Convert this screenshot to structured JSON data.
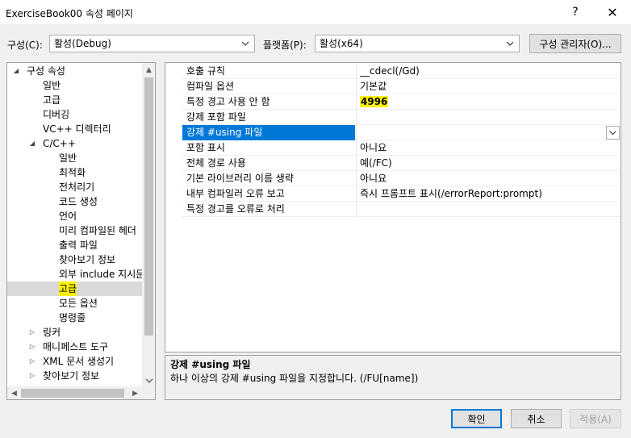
{
  "window": {
    "title": "ExerciseBook00 속성 페이지",
    "help_glyph": "?",
    "close_glyph": "✕"
  },
  "toolbar": {
    "config_label": "구성(C):",
    "config_value": "활성(Debug)",
    "platform_label": "플랫폼(P):",
    "platform_value": "활성(x64)",
    "config_manager_label": "구성 관리자(O)..."
  },
  "tree": {
    "items": [
      {
        "label": "구성 속성",
        "indent": 0,
        "expander": "expanded"
      },
      {
        "label": "일반",
        "indent": 1,
        "expander": "none"
      },
      {
        "label": "고급",
        "indent": 1,
        "expander": "none"
      },
      {
        "label": "디버깅",
        "indent": 1,
        "expander": "none"
      },
      {
        "label": "VC++ 디렉터리",
        "indent": 1,
        "expander": "none"
      },
      {
        "label": "C/C++",
        "indent": 1,
        "expander": "expanded"
      },
      {
        "label": "일반",
        "indent": 2,
        "expander": "none"
      },
      {
        "label": "최적화",
        "indent": 2,
        "expander": "none"
      },
      {
        "label": "전처리기",
        "indent": 2,
        "expander": "none"
      },
      {
        "label": "코드 생성",
        "indent": 2,
        "expander": "none"
      },
      {
        "label": "언어",
        "indent": 2,
        "expander": "none"
      },
      {
        "label": "미리 컴파일된 헤더",
        "indent": 2,
        "expander": "none"
      },
      {
        "label": "출력 파일",
        "indent": 2,
        "expander": "none"
      },
      {
        "label": "찾아보기 정보",
        "indent": 2,
        "expander": "none"
      },
      {
        "label": "외부 include 지시문",
        "indent": 2,
        "expander": "none"
      },
      {
        "label": "고급",
        "indent": 2,
        "expander": "none",
        "selected": true
      },
      {
        "label": "모든 옵션",
        "indent": 2,
        "expander": "none"
      },
      {
        "label": "명령줄",
        "indent": 2,
        "expander": "none"
      },
      {
        "label": "링커",
        "indent": 1,
        "expander": "collapsed"
      },
      {
        "label": "매니페스트 도구",
        "indent": 1,
        "expander": "collapsed"
      },
      {
        "label": "XML 문서 생성기",
        "indent": 1,
        "expander": "collapsed"
      },
      {
        "label": "찾아보기 정보",
        "indent": 1,
        "expander": "collapsed"
      }
    ]
  },
  "grid": {
    "rows": [
      {
        "name": "호출 규칙",
        "value": "__cdecl(/Gd)"
      },
      {
        "name": "컴파일 옵션",
        "value": "기본값"
      },
      {
        "name": "특정 경고 사용 안 함",
        "value": "4996",
        "highlight": true
      },
      {
        "name": "강제 포함 파일",
        "value": ""
      },
      {
        "name": "강제 #using 파일",
        "value": "",
        "selected": true
      },
      {
        "name": "포함 표시",
        "value": "아니요"
      },
      {
        "name": "전체 경로 사용",
        "value": "예(/FC)"
      },
      {
        "name": "기본 라이브러리 이름 생략",
        "value": "아니요"
      },
      {
        "name": "내부 컴파일러 오류 보고",
        "value": "즉시 프롬프트 표시(/errorReport:prompt)"
      },
      {
        "name": "특정 경고를 오류로 처리",
        "value": ""
      }
    ]
  },
  "description": {
    "title": "강제 #using 파일",
    "text": "하나 이상의 강제 #using 파일을 지정합니다.     (/FU[name])"
  },
  "buttons": {
    "ok": "확인",
    "cancel": "취소",
    "apply": "적용(A)"
  }
}
